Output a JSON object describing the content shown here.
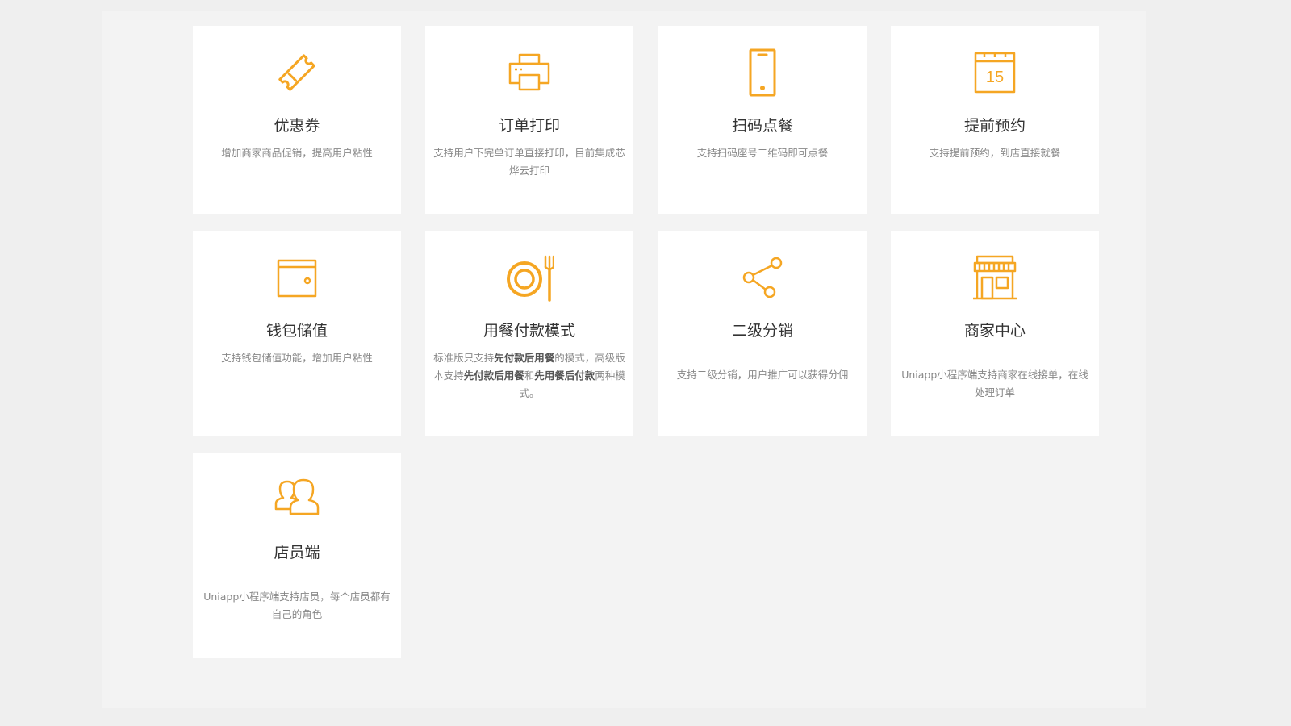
{
  "accent_color": "#F5A623",
  "features": [
    {
      "icon": "coupon-icon",
      "title": "优惠券",
      "desc": "增加商家商品促销，提高用户粘性"
    },
    {
      "icon": "printer-icon",
      "title": "订单打印",
      "desc": "支持用户下完单订单直接打印，目前集成芯烨云打印"
    },
    {
      "icon": "smartphone-icon",
      "title": "扫码点餐",
      "desc": "支持扫码座号二维码即可点餐"
    },
    {
      "icon": "calendar-icon",
      "title": "提前预约",
      "desc": "支持提前预约，到店直接就餐",
      "icon_text": "15"
    },
    {
      "icon": "wallet-icon",
      "title": "钱包储值",
      "desc": "支持钱包储值功能，增加用户粘性"
    },
    {
      "icon": "plate-fork-icon",
      "title": "用餐付款模式",
      "desc_parts": [
        "标准版只支持",
        "先付款后用餐",
        "的模式，高级版本支持",
        "先付款后用餐",
        "和",
        "先用餐后付款",
        "两种模式。"
      ]
    },
    {
      "icon": "share-icon",
      "title": "二级分销",
      "desc": "支持二级分销，用户推广可以获得分佣"
    },
    {
      "icon": "store-icon",
      "title": "商家中心",
      "desc": "Uniapp小程序端支持商家在线接单，在线处理订单"
    },
    {
      "icon": "users-icon",
      "title": "店员端",
      "desc": "Uniapp小程序端支持店员，每个店员都有自己的角色"
    }
  ]
}
